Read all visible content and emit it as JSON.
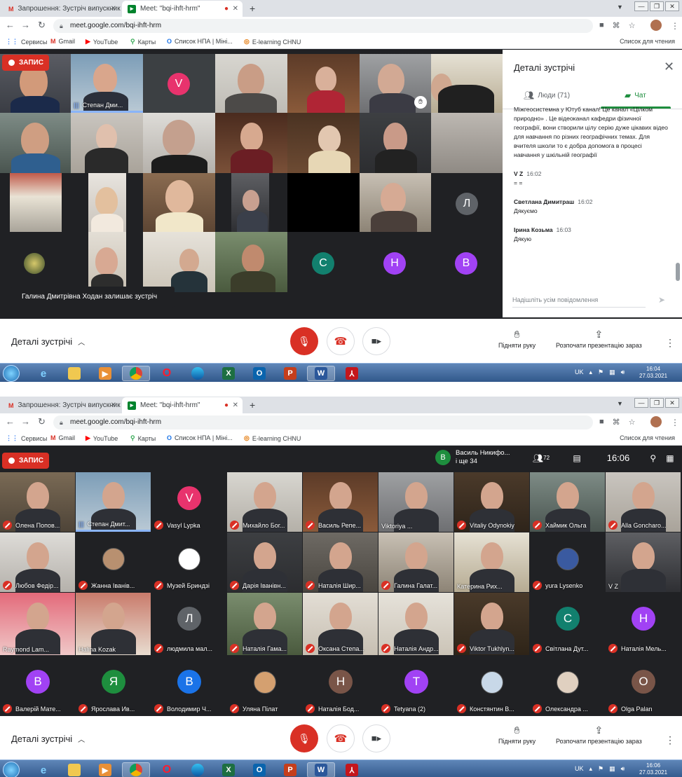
{
  "browser": {
    "tabs": [
      {
        "label": "Запрошення: Зустріч випускникі",
        "icon": "gmail-icon"
      },
      {
        "label": "Meet: \"bqi-ihft-hrm\"",
        "icon": "meet-icon"
      }
    ],
    "url": "meet.google.com/bqi-ihft-hrm",
    "bookmarks": [
      "Сервисы",
      "Gmail",
      "YouTube",
      "Карты",
      "Список НПА | Міні...",
      "E-learning CHNU"
    ],
    "reading_list": "Список для чтения"
  },
  "meet1": {
    "recording": "ЗАПИС",
    "speaker_name": "Степан Дми...",
    "letters": [
      "V",
      "Л",
      "С",
      "Н",
      "В"
    ],
    "toast": "Галина Дмитрівна Ходан залишає зустріч",
    "panel": {
      "title": "Деталі зустрічі",
      "people_tab": "Люди (71)",
      "chat_tab": "Чат",
      "messages": [
        {
          "sender": "",
          "time": "",
          "text": "Міжгеосистемна у Ютуб канал! Це канал «Цілком природно» . Це відеоканал кафедри фізичної географії, вони створили цілу серію дуже цікавих відео для навчання по різних географічних темах. Для вчителя школи  то є добра допомога в процесі навчання у шкільній географії"
        },
        {
          "sender": "V Z",
          "time": "16:02",
          "text": "= ="
        },
        {
          "sender": "Светлана Димитраш",
          "time": "16:02",
          "text": "Дякуємо"
        },
        {
          "sender": "Ірина Козьма",
          "time": "16:03",
          "text": "Дякую"
        }
      ],
      "input_placeholder": "Надішліть усім повідомлення"
    }
  },
  "meet2": {
    "recording": "ЗАПИС",
    "presenter": {
      "name": "Василь Никифо...",
      "more": "і ще 34",
      "initial": "В"
    },
    "people_count": "72",
    "clock": "16:06",
    "participants": [
      "Олена Попов...",
      "Степан Дмит...",
      "Vasyl Lypka",
      "Михайло Бог...",
      "Василь Репе...",
      "Viktoriya ...",
      "Vitaliy Odynokiy",
      "Хаймик Ольга",
      "Alla Goncharo...",
      "Любов Федір...",
      "Жанна Іванів...",
      "Музей Бриндзі",
      "Дарія Іванівн...",
      "Наталія Шир...",
      "Галина Галат...",
      "Катерина Рих...",
      "yura Lysenko",
      "V Z",
      "Raymond Lam...",
      "Halina Kozak",
      "людмила мал...",
      "Наталія Гама...",
      "Оксана Степа...",
      "Наталія Андр...",
      "Viktor Tukhlyn...",
      "Світлана Дут...",
      "Наталія Мель...",
      "Валерій Мате...",
      "Ярослава Ив...",
      "Володимир Ч...",
      "Уляна Пілат",
      "Наталія Бод...",
      "Tetyana (2)",
      "Констянтин В...",
      "Олександра ...",
      "Olga Palan"
    ],
    "letters": {
      "vasyl": "V",
      "lyudmyla": "Л",
      "svitlana": "С",
      "natalia": "Н",
      "valeriy": "В",
      "yaroslava": "Я",
      "volodymyr": "В",
      "natalia_bod": "Н",
      "tetyana": "Т",
      "olga": "О"
    }
  },
  "controls": {
    "details": "Деталі зустрічі",
    "raise_hand": "Підняти руку",
    "present": "Розпочати презентацію зараз"
  },
  "taskbar": {
    "lang": "UK",
    "clock1": {
      "time": "16:04",
      "date": "27.03.2021"
    },
    "clock2": {
      "time": "16:06",
      "date": "27.03.2021"
    }
  },
  "colors": {
    "accent_green": "#1e8e3e",
    "end_red": "#d93025",
    "dark_bg": "#202124",
    "letter_purple": "#a142f4",
    "letter_teal": "#12806e",
    "letter_pink": "#e8336d",
    "letter_gray": "#5f6368"
  }
}
